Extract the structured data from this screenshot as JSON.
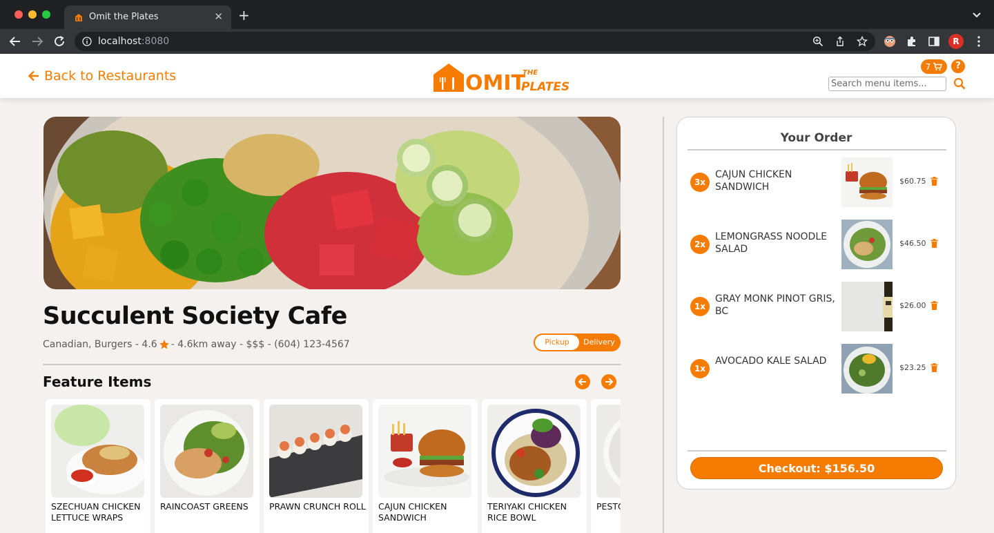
{
  "browser": {
    "tab_title": "Omit the Plates",
    "url_host": "localhost",
    "url_port": ":8080",
    "profile_initial": "R"
  },
  "header": {
    "back_label": "Back to Restaurants",
    "logo_text": "OMIT",
    "logo_the": "THE",
    "logo_plates": "PLATES",
    "cart_count": "7",
    "help_label": "?",
    "search_placeholder": "Search menu items..."
  },
  "restaurant": {
    "name": "Succulent Society Cafe",
    "meta_before_star": "Canadian, Burgers - 4.6",
    "meta_after_star": " - 4.6km away - $$$ - (604) 123-4567",
    "rating": 4.6,
    "mode_pickup": "Pickup",
    "mode_delivery": "Delivery",
    "mode_selected": "Pickup"
  },
  "featured": {
    "title": "Feature Items",
    "items": [
      {
        "label": "SZECHUAN CHICKEN LETTUCE WRAPS"
      },
      {
        "label": "RAINCOAST GREENS"
      },
      {
        "label": "PRAWN CRUNCH ROLL"
      },
      {
        "label": "CAJUN CHICKEN SANDWICH"
      },
      {
        "label": "TERIYAKI CHICKEN RICE BOWL"
      },
      {
        "label": "PESTO QUES"
      }
    ]
  },
  "order": {
    "title": "Your Order",
    "items": [
      {
        "qty": "3x",
        "name": "CAJUN CHICKEN SANDWICH",
        "price": "$60.75"
      },
      {
        "qty": "2x",
        "name": "LEMONGRASS NOODLE SALAD",
        "price": "$46.50"
      },
      {
        "qty": "1x",
        "name": "GRAY MONK PINOT GRIS, BC",
        "price": "$26.00"
      },
      {
        "qty": "1x",
        "name": "AVOCADO KALE SALAD",
        "price": "$23.25"
      }
    ],
    "checkout_label": "Checkout: $156.50"
  },
  "colors": {
    "accent": "#f57c00",
    "background": "#f4f1ee"
  }
}
